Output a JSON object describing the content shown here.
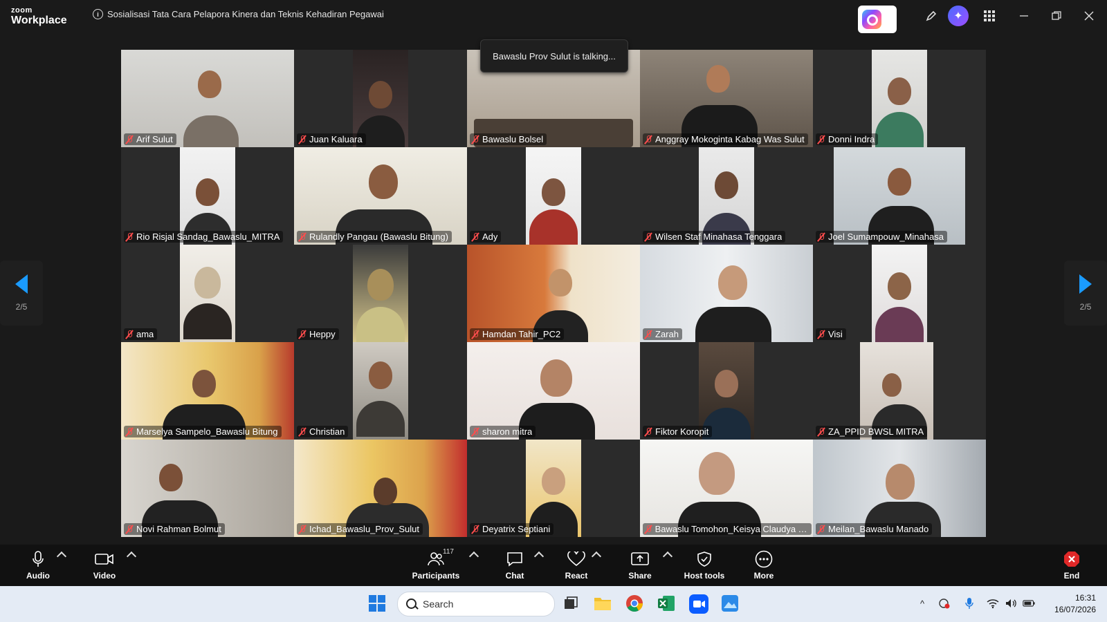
{
  "app": {
    "brand_top": "zoom",
    "brand_bottom": "Workplace"
  },
  "meeting": {
    "title": "Sosialisasi Tata Cara Pelapora Kinera dan Teknis Kehadiran Pegawai",
    "talking": "Bawaslu Prov Sulut is talking..."
  },
  "participants": [
    {
      "name": "Arif Sulut"
    },
    {
      "name": "Juan Kaluara"
    },
    {
      "name": "Bawaslu Bolsel"
    },
    {
      "name": "Anggray Mokoginta Kabag Was Sulut"
    },
    {
      "name": "Donni Indra"
    },
    {
      "name": "Rio Risjal Sandag_Bawaslu_MITRA"
    },
    {
      "name": "Rulandly Pangau (Bawaslu Bitung)"
    },
    {
      "name": "Ady"
    },
    {
      "name": "Wilsen Staf Minahasa Tenggara"
    },
    {
      "name": "Joel Sumampouw_Minahasa"
    },
    {
      "name": "ama"
    },
    {
      "name": "Heppy"
    },
    {
      "name": "Hamdan Tahir_PC2"
    },
    {
      "name": "Zarah"
    },
    {
      "name": "Visi"
    },
    {
      "name": "Marselya Sampelo_Bawaslu Bitung"
    },
    {
      "name": "Christian"
    },
    {
      "name": "sharon mitra"
    },
    {
      "name": "Fiktor Koropit"
    },
    {
      "name": "ZA_PPID BWSL MITRA"
    },
    {
      "name": "Novi Rahman Bolmut"
    },
    {
      "name": "Ichad_Bawaslu_Prov_Sulut"
    },
    {
      "name": "Deyatrix Septiani"
    },
    {
      "name": "Bawaslu Tomohon_Keisya Claudya Ta..."
    },
    {
      "name": "Meilan_Bawaslu Manado"
    }
  ],
  "pagination": {
    "left": "2/5",
    "right": "2/5"
  },
  "toolbar": {
    "audio": "Audio",
    "video": "Video",
    "participants": "Participants",
    "participant_count": "117",
    "chat": "Chat",
    "react": "React",
    "share": "Share",
    "host_tools": "Host tools",
    "more": "More",
    "end": "End"
  },
  "taskbar": {
    "search": "Search",
    "time": "16:31",
    "date": "16/07/2026"
  },
  "colors": {
    "accent": "#0b5cff",
    "end": "#e02828",
    "nav_arrow": "#1a9bff"
  }
}
